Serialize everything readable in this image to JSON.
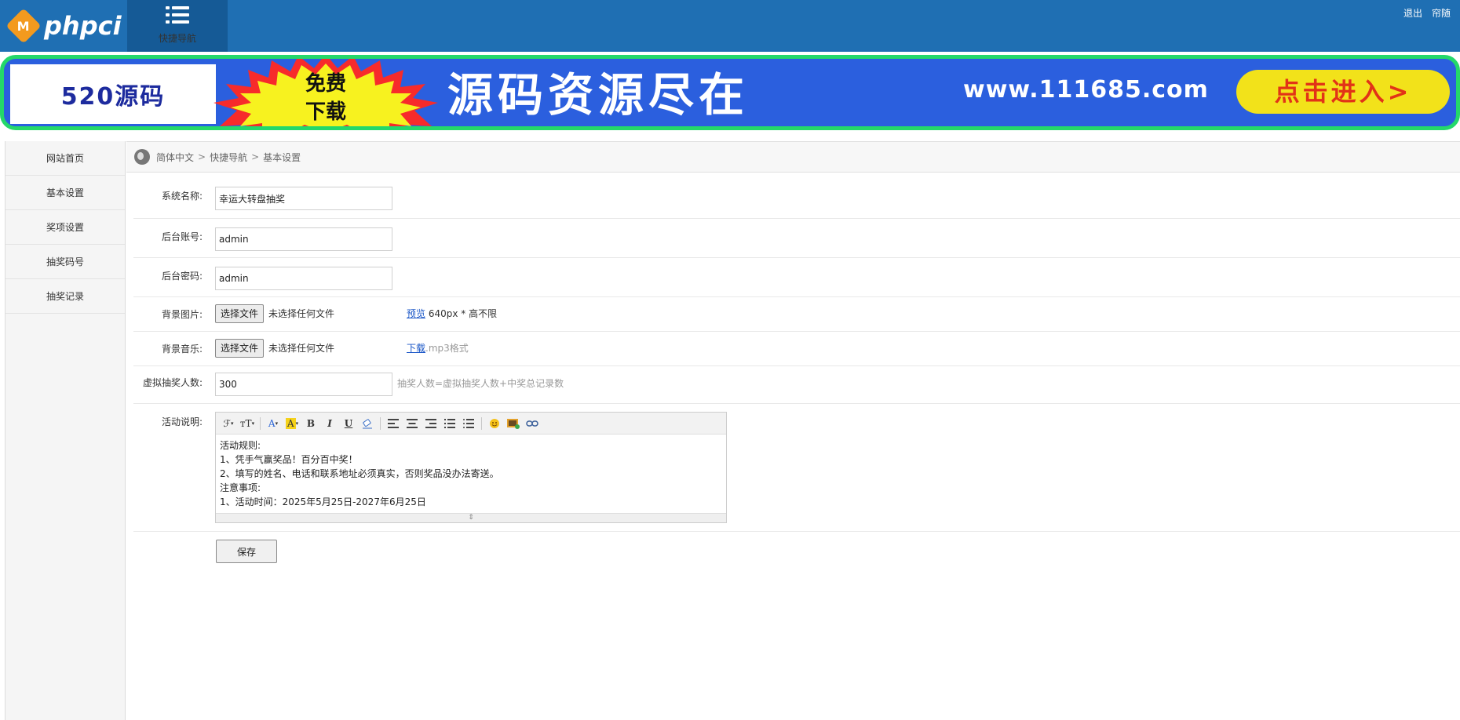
{
  "header": {
    "logo_letter": "M",
    "logo_text": "phpci",
    "quicknav_label": "快捷导航",
    "links": [
      "退出",
      "帘随"
    ]
  },
  "banner": {
    "brand": "520源码",
    "burst_line1": "免费",
    "burst_line2": "下载",
    "title": "源码资源尽在",
    "url": "www.111685.com",
    "button": "点击进入>"
  },
  "sidebar": {
    "items": [
      {
        "label": "网站首页"
      },
      {
        "label": "基本设置"
      },
      {
        "label": "奖项设置"
      },
      {
        "label": "抽奖码号"
      },
      {
        "label": "抽奖记录"
      }
    ]
  },
  "breadcrumb": {
    "items": [
      "简体中文",
      "快捷导航",
      "基本设置"
    ],
    "separator": ">"
  },
  "form": {
    "system_name": {
      "label": "系统名称:",
      "value": "幸运大转盘抽奖"
    },
    "admin_account": {
      "label": "后台账号:",
      "value": "admin"
    },
    "admin_password": {
      "label": "后台密码:",
      "value": "admin"
    },
    "background_image": {
      "label": "背景图片:",
      "button": "选择文件",
      "status": "未选择任何文件",
      "link": "预览",
      "hint": "640px * 高不限"
    },
    "background_music": {
      "label": "背景音乐:",
      "button": "选择文件",
      "status": "未选择任何文件",
      "link": "下载",
      "hint": ".mp3格式"
    },
    "virtual_count": {
      "label": "虚拟抽奖人数:",
      "value": "300",
      "hint": "抽奖人数=虚拟抽奖人数+中奖总记录数"
    },
    "description": {
      "label": "活动说明:",
      "lines": [
        "活动规则:",
        "1、凭手气赢奖品！百分百中奖！",
        "2、填写的姓名、电话和联系地址必须真实，否则奖品没办法寄送。",
        "注意事项:",
        "1、活动时间：2025年5月25日-2027年6月25日"
      ]
    },
    "save_button": "保存"
  },
  "editor_toolbar": {
    "font_family": "ℱ",
    "font_size": "тT",
    "font_color": "A",
    "highlight": "A",
    "bold": "B",
    "italic": "I",
    "underline": "U"
  },
  "colors": {
    "header_bg": "#1f6fb3",
    "quicknav_bg": "#155a96",
    "banner_bg": "#2b5fde",
    "banner_border": "#24d86a",
    "button_yellow": "#f2e21a",
    "link_blue": "#1a56c7"
  }
}
